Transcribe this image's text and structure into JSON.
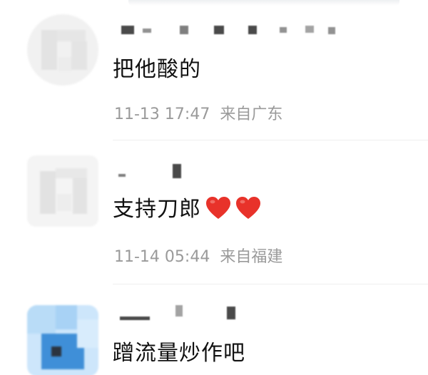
{
  "comments": [
    {
      "text": "把他酸的",
      "date": "11-13 17:47",
      "location": "来自广东",
      "emoji": []
    },
    {
      "text": "支持刀郎",
      "date": "11-14 05:44",
      "location": "来自福建",
      "emoji": [
        "red-heart",
        "red-heart"
      ]
    },
    {
      "text": "蹭流量炒作吧",
      "date": "",
      "location": "",
      "emoji": []
    }
  ],
  "colors": {
    "heart": "#e8322a",
    "meta_text": "#9a9a9a",
    "body_text": "#111111"
  }
}
